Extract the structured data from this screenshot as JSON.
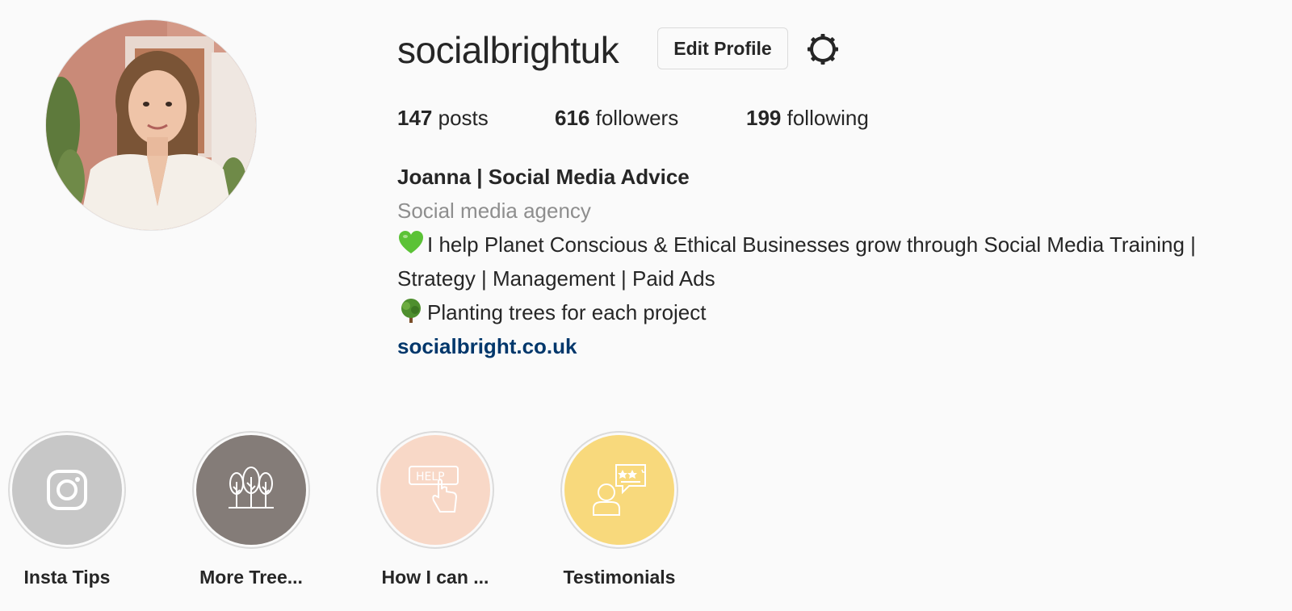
{
  "profile": {
    "username": "socialbrightuk",
    "edit_profile_label": "Edit Profile",
    "avatar_alt": "profile photo"
  },
  "stats": {
    "posts_count": "147",
    "posts_label": "posts",
    "followers_count": "616",
    "followers_label": "followers",
    "following_count": "199",
    "following_label": "following"
  },
  "bio": {
    "name": "Joanna | Social Media Advice",
    "category": "Social media agency",
    "line1_emoji": "green-heart-icon",
    "line1": "I help Planet Conscious & Ethical Businesses grow through Social Media Training | Strategy | Management | Paid Ads",
    "line2_emoji": "tree-icon",
    "line2": "Planting trees for each project",
    "link": "socialbright.co.uk"
  },
  "highlights": [
    {
      "label": "Insta Tips",
      "icon": "instagram-icon",
      "color": "#c7c7c7"
    },
    {
      "label": "More Tree...",
      "icon": "trees-icon",
      "color": "#847c78"
    },
    {
      "label": "How I can ...",
      "icon": "help-hand-icon",
      "color": "#f8d8c7"
    },
    {
      "label": "Testimonials",
      "icon": "testimonial-icon",
      "color": "#f8d97c"
    }
  ],
  "colors": {
    "background": "#fafafa",
    "text": "#262626",
    "secondary_text": "#8e8e8e",
    "link": "#00376b",
    "border": "#dbdbdb"
  }
}
